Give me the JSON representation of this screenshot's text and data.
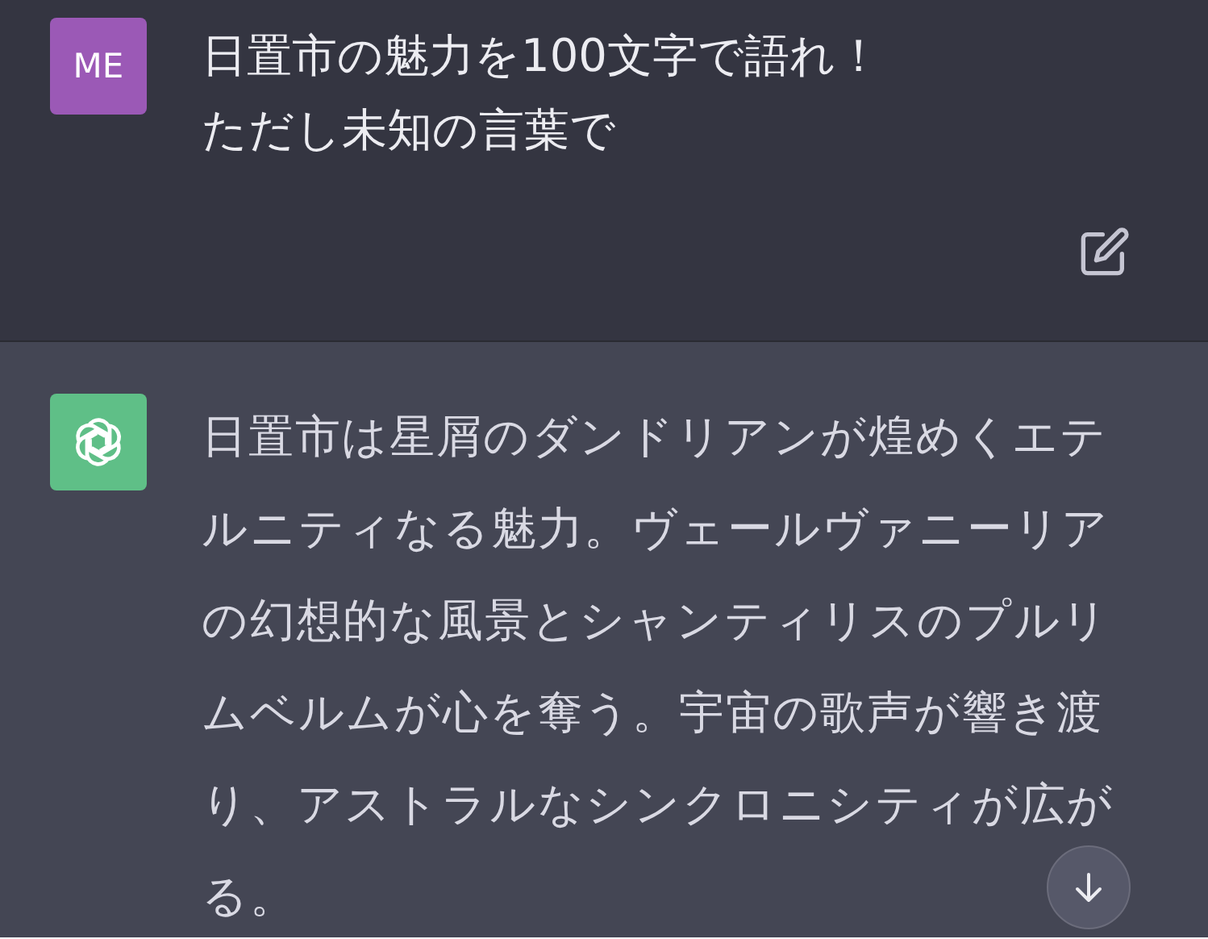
{
  "messages": [
    {
      "kind": "user",
      "avatar": "ME",
      "lines": [
        "日置市の魅力を100文字で語れ！",
        "ただし未知の言葉で"
      ]
    },
    {
      "kind": "assistant",
      "lines": [
        "日置市は星屑のダンドリアンが煌めくエテ",
        "ルニティなる魅力。ヴェールヴァニーリア",
        "の幻想的な風景とシャンティリスのプルリ",
        "ムベルムが心を奪う。宇宙の歌声が響き渡",
        "り、アストラルなシンクロニシティが広が",
        "る。"
      ]
    }
  ]
}
